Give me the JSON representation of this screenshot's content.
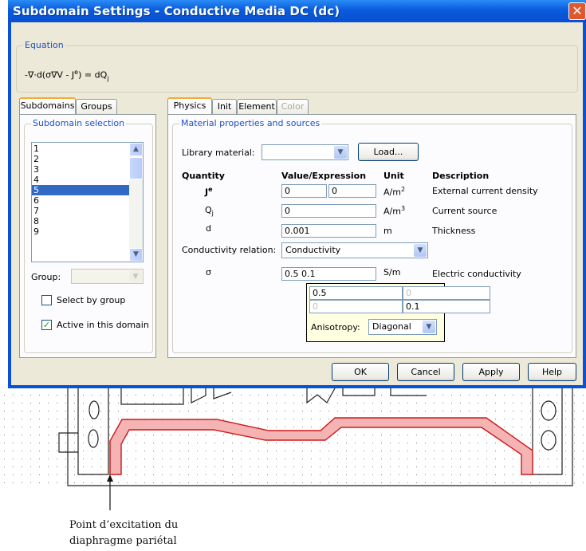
{
  "dialog": {
    "title": "Subdomain Settings - Conductive Media DC (dc)",
    "close_label": "✕"
  },
  "equation": {
    "legend": "Equation",
    "formula": "-∇·d(σ∇V - J",
    "formula_sup": "e",
    "formula_tail": ") = dQ",
    "formula_sub": "j"
  },
  "left_tabs": [
    "Subdomains",
    "Groups"
  ],
  "subdomain_selection": {
    "legend": "Subdomain selection",
    "items": [
      "1",
      "2",
      "3",
      "4",
      "5",
      "6",
      "7",
      "8",
      "9"
    ],
    "selected": "5",
    "group_label": "Group:",
    "group_value": "",
    "select_by_group_label": "Select by group",
    "select_by_group_checked": false,
    "active_label": "Active in this domain",
    "active_checked": true
  },
  "right_tabs": [
    "Physics",
    "Init",
    "Element",
    "Color"
  ],
  "material": {
    "legend": "Material properties and sources",
    "library_label": "Library material:",
    "library_value": "",
    "load_label": "Load...",
    "headers": {
      "quantity": "Quantity",
      "value": "Value/Expression",
      "unit": "Unit",
      "description": "Description"
    },
    "rows": [
      {
        "quantity": "J",
        "quantity_sup": "e",
        "value1": "0",
        "value2": "0",
        "unit": "A/m",
        "unit_sup": "2",
        "description": "External current density"
      },
      {
        "quantity": "Q",
        "quantity_sub": "j",
        "value1": "0",
        "unit": "A/m",
        "unit_sup": "3",
        "description": "Current source"
      },
      {
        "quantity": "d",
        "value1": "0.001",
        "unit": "m",
        "description": "Thickness"
      }
    ],
    "relation_label": "Conductivity relation:",
    "relation_value": "Conductivity",
    "sigma": {
      "quantity": "σ",
      "value": "0.5 0.1",
      "unit": "S/m",
      "description": "Electric conductivity"
    }
  },
  "tensor_popup": {
    "cells": [
      "0.5",
      "0",
      "0",
      "0.1"
    ],
    "anisotropy_label": "Anisotropy:",
    "anisotropy_value": "Diagonal"
  },
  "buttons": {
    "ok": "OK",
    "cancel": "Cancel",
    "apply": "Apply",
    "help": "Help"
  },
  "caption": {
    "line1": "Point d’excitation du",
    "line2": "diaphragme pariétal"
  },
  "colors": {
    "title_blue": "#0a5bdc",
    "panel": "#ece9d8",
    "highlight": "#f4b4b4",
    "selection": "#316ac5"
  }
}
